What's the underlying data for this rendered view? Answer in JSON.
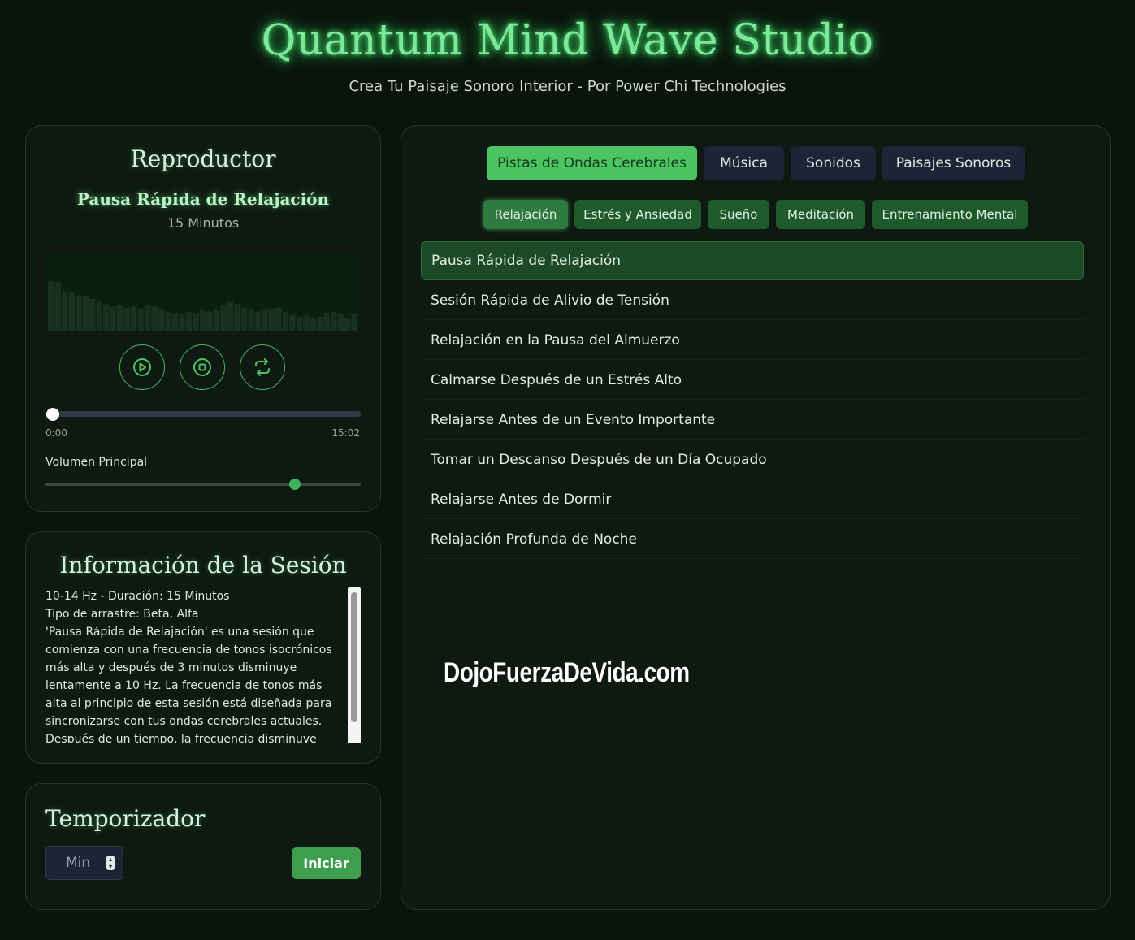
{
  "header": {
    "title": "Quantum Mind Wave Studio",
    "subtitle": "Crea Tu Paisaje Sonoro Interior - Por Power Chi Technologies"
  },
  "player": {
    "heading": "Reproductor",
    "track_title": "Pausa Rápida de Relajación",
    "track_duration": "15 Minutos",
    "time_current": "0:00",
    "time_total": "15:02",
    "progress": 0,
    "volume_label": "Volumen Principal",
    "volume": 0.79,
    "visualizer_levels": [
      0.78,
      0.76,
      0.62,
      0.6,
      0.56,
      0.55,
      0.5,
      0.45,
      0.42,
      0.38,
      0.4,
      0.36,
      0.38,
      0.35,
      0.4,
      0.38,
      0.35,
      0.3,
      0.28,
      0.26,
      0.3,
      0.28,
      0.32,
      0.3,
      0.34,
      0.4,
      0.46,
      0.42,
      0.36,
      0.34,
      0.3,
      0.32,
      0.34,
      0.36,
      0.3,
      0.25,
      0.22,
      0.24,
      0.2,
      0.22,
      0.28,
      0.3,
      0.26,
      0.2,
      0.28
    ],
    "controls": {
      "play_icon": "play-icon",
      "stop_icon": "stop-icon",
      "loop_icon": "loop-icon"
    }
  },
  "session": {
    "heading": "Información de la Sesión",
    "lines": [
      "10-14 Hz - Duración: 15 Minutos",
      "Tipo de arrastre: Beta, Alfa",
      "'Pausa Rápida de Relajación' es una sesión que comienza con una frecuencia de tonos isocrónicos más alta y después de 3 minutos disminuye lentamente a 10 Hz. La frecuencia de tonos más alta al principio de esta sesión está diseñada para sincronizarse con tus ondas cerebrales actuales. Después de un tiempo, la frecuencia disminuye"
    ]
  },
  "timer": {
    "heading": "Temporizador",
    "input_placeholder": "Min",
    "start_label": "Iniciar"
  },
  "library": {
    "tabs": [
      {
        "label": "Pistas de Ondas Cerebrales",
        "active": true
      },
      {
        "label": "Música",
        "active": false
      },
      {
        "label": "Sonidos",
        "active": false
      },
      {
        "label": "Paisajes Sonoros",
        "active": false
      }
    ],
    "subtabs": [
      {
        "label": "Relajación",
        "active": true
      },
      {
        "label": "Estrés y Ansiedad",
        "active": false
      },
      {
        "label": "Sueño",
        "active": false
      },
      {
        "label": "Meditación",
        "active": false
      },
      {
        "label": "Entrenamiento Mental",
        "active": false
      }
    ],
    "tracks": [
      {
        "title": "Pausa Rápida de Relajación",
        "active": true
      },
      {
        "title": "Sesión Rápida de Alivio de Tensión",
        "active": false
      },
      {
        "title": "Relajación en la Pausa del Almuerzo",
        "active": false
      },
      {
        "title": "Calmarse Después de un Estrés Alto",
        "active": false
      },
      {
        "title": "Relajarse Antes de un Evento Importante",
        "active": false
      },
      {
        "title": "Tomar un Descanso Después de un Día Ocupado",
        "active": false
      },
      {
        "title": "Relajarse Antes de Dormir",
        "active": false
      },
      {
        "title": "Relajación Profunda de Noche",
        "active": false
      }
    ]
  },
  "watermark": "DojoFuerzaDeVida.com",
  "colors": {
    "accent": "#4cc462",
    "glow": "#7ee89a",
    "panel_bg": "#0e1a11",
    "page_bg": "#0b130d"
  }
}
